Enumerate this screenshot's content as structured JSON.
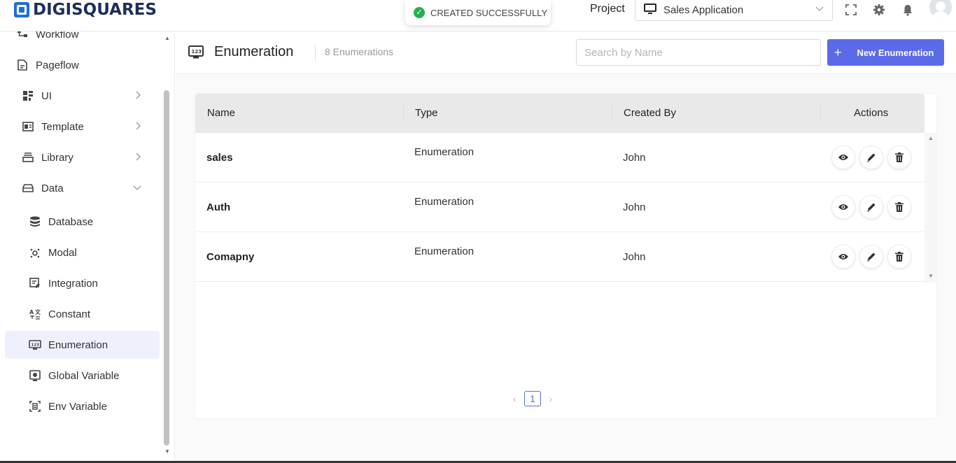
{
  "header": {
    "logo_text": "DIGISQUARES",
    "toast": "CREATED SUCCESSFULLY",
    "project_label": "Project",
    "project_value": "Sales Application"
  },
  "sidebar": {
    "items": [
      {
        "label": "Workflow",
        "icon": "workflow-icon"
      },
      {
        "label": "Pageflow",
        "icon": "pageflow-icon"
      },
      {
        "label": "UI",
        "icon": "ui-grid-icon",
        "expandable": true
      },
      {
        "label": "Template",
        "icon": "template-icon",
        "expandable": true
      },
      {
        "label": "Library",
        "icon": "library-icon",
        "expandable": true
      },
      {
        "label": "Data",
        "icon": "data-icon",
        "expanded": true
      },
      {
        "label": "Database",
        "icon": "database-icon"
      },
      {
        "label": "Modal",
        "icon": "modal-icon"
      },
      {
        "label": "Integration",
        "icon": "integration-icon"
      },
      {
        "label": "Constant",
        "icon": "constant-icon"
      },
      {
        "label": "Enumeration",
        "icon": "enumeration-icon",
        "active": true
      },
      {
        "label": "Global Variable",
        "icon": "global-variable-icon"
      },
      {
        "label": "Env Variable",
        "icon": "env-variable-icon"
      }
    ]
  },
  "page": {
    "title": "Enumeration",
    "count": "8 Enumerations",
    "search_placeholder": "Search by Name",
    "new_button": "New Enumeration"
  },
  "table": {
    "columns": [
      "Name",
      "Type",
      "Created By",
      "Actions"
    ],
    "rows": [
      {
        "name": "sales",
        "type": "Enumeration",
        "created_by": "John"
      },
      {
        "name": "Auth",
        "type": "Enumeration",
        "created_by": "John"
      },
      {
        "name": "Comapny",
        "type": "Enumeration",
        "created_by": "John"
      }
    ]
  },
  "pagination": {
    "current": "1"
  },
  "colors": {
    "accent": "#5b6be8",
    "success": "#26b04f",
    "active_bg": "#eef1fb"
  }
}
